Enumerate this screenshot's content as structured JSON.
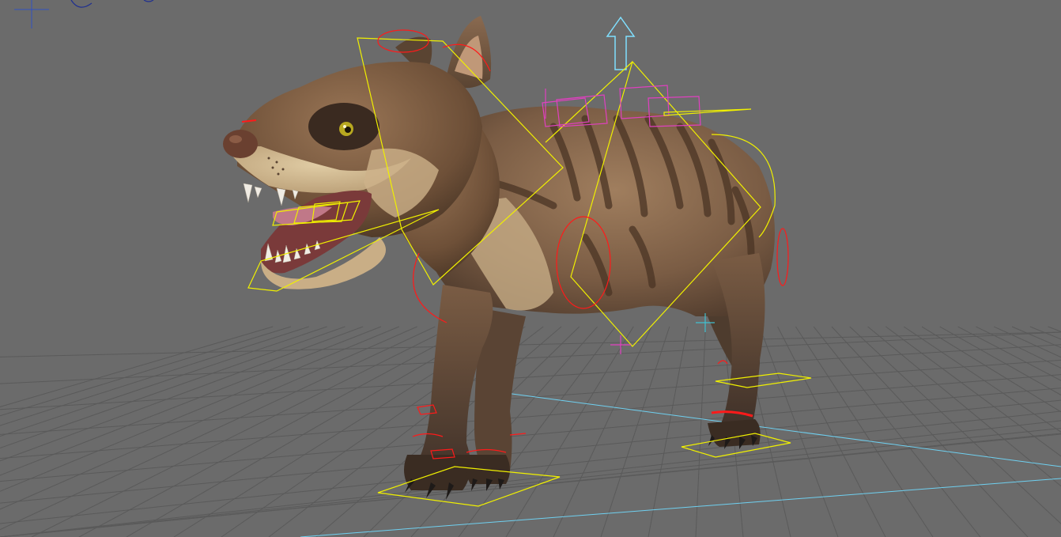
{
  "viewport": {
    "kind": "3d-viewport",
    "background_color": "#6b6b6b",
    "grid_color": "#5a5a5a",
    "axis_line_color": "#6fd0f0"
  },
  "model": {
    "subject": "creature-rig",
    "fur_color": "#8a6a4e",
    "belly_color": "#c9b08a",
    "paw_color": "#4a3a2e",
    "mouth_color": "#a0506a"
  },
  "controls": {
    "fk_ik_color": "#f0f000",
    "joint_color": "#ff1a1a",
    "spine_color": "#e040c0",
    "world_arrow_color": "#80e0ff"
  }
}
